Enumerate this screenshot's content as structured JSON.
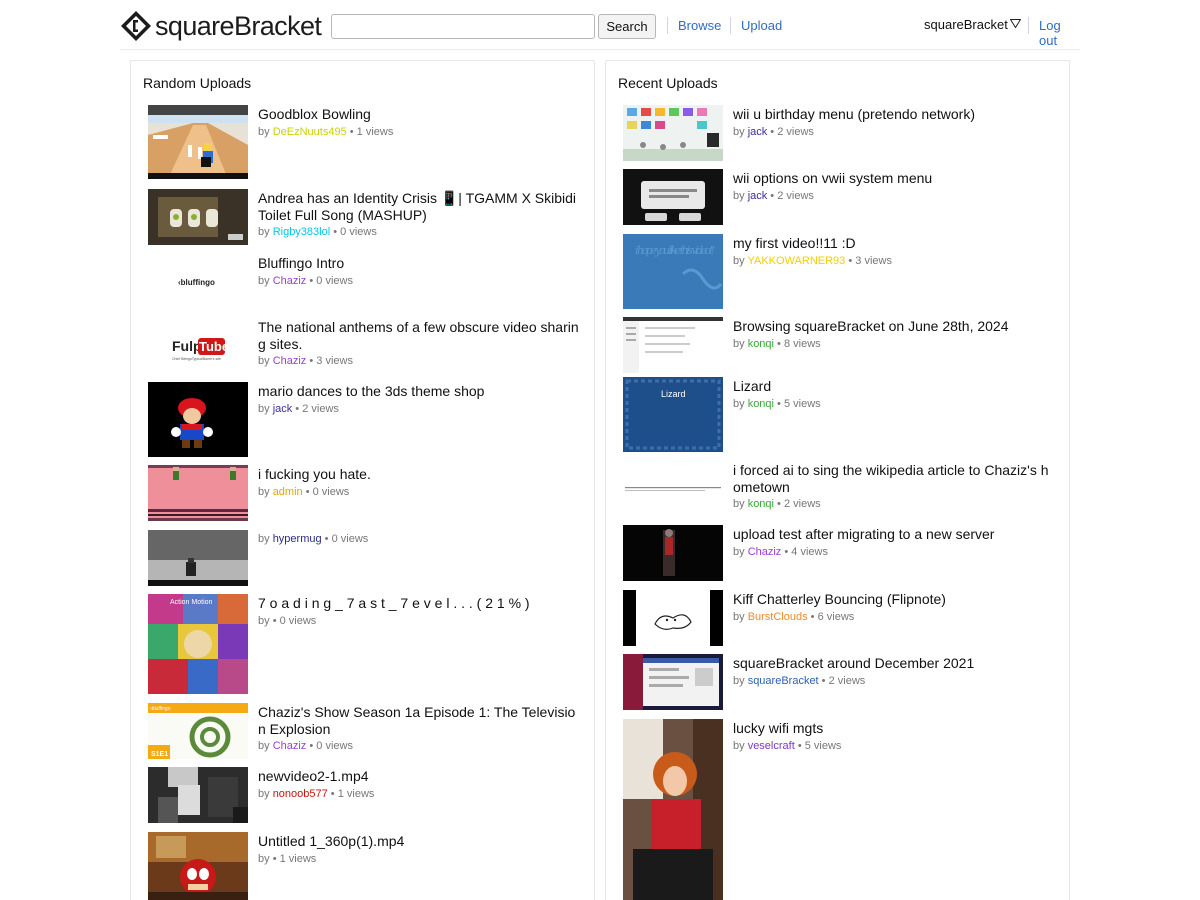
{
  "header": {
    "logo_text": "squareBracket",
    "search_placeholder": "",
    "search_button": "Search",
    "nav_browse": "Browse",
    "nav_upload": "Upload",
    "user_name": "squareBracket",
    "logout": "Log out"
  },
  "random": {
    "title": "Random Uploads",
    "videos": [
      {
        "title": "Goodblox Bowling",
        "user": "DeEzNuuts495",
        "user_color": "#c8d400",
        "views": "1 views"
      },
      {
        "title": "Andrea has an Identity Crisis 📱| TGAMM X Skibidi Toilet Full Song (MASHUP)",
        "user": "Rigby383lol",
        "user_color": "#00c8e6",
        "views": "0 views"
      },
      {
        "title": "Bluffingo Intro",
        "user": "Chaziz",
        "user_color": "#9b3dd6",
        "views": "0 views"
      },
      {
        "title": "The national anthems of a few obscure video sharing sites.",
        "user": "Chaziz",
        "user_color": "#9b3dd6",
        "views": "3 views"
      },
      {
        "title": "mario dances to the 3ds theme shop",
        "user": "jack",
        "user_color": "#3a2fa3",
        "views": "2 views"
      },
      {
        "title": "i fucking you hate.",
        "user": "admin",
        "user_color": "#e0a800",
        "views": "0 views"
      },
      {
        "title": "",
        "user": "hypermug",
        "user_color": "#2b2b8f",
        "views": "0 views"
      },
      {
        "title": "7 o a d i n g _ 7 a s t _ 7 e v e l . . . ( 2 1 % )",
        "user": "",
        "user_color": "#777777",
        "views": "0 views"
      },
      {
        "title": "Chaziz's Show Season 1a Episode 1: The Television Explosion",
        "user": "Chaziz",
        "user_color": "#9b3dd6",
        "views": "0 views"
      },
      {
        "title": "newvideo2-1.mp4",
        "user": "nonoob577",
        "user_color": "#cc1111",
        "views": "1 views"
      },
      {
        "title": "Untitled 1_360p(1).mp4",
        "user": "",
        "user_color": "#777777",
        "views": "1 views"
      }
    ]
  },
  "recent": {
    "title": "Recent Uploads",
    "videos": [
      {
        "title": "wii u birthday menu (pretendo network)",
        "user": "jack",
        "user_color": "#3a2fa3",
        "views": "2 views"
      },
      {
        "title": "wii options on vwii system menu",
        "user": "jack",
        "user_color": "#3a2fa3",
        "views": "2 views"
      },
      {
        "title": "my first video!!11 :D",
        "user": "YAKKOWARNER93",
        "user_color": "#f2d000",
        "views": "3 views"
      },
      {
        "title": "Browsing squareBracket on June 28th, 2024",
        "user": "konqi",
        "user_color": "#3aa83a",
        "views": "8 views"
      },
      {
        "title": "Lizard",
        "user": "konqi",
        "user_color": "#3aa83a",
        "views": "5 views"
      },
      {
        "title": "i forced ai to sing the wikipedia article to Chaziz's hometown",
        "user": "konqi",
        "user_color": "#3aa83a",
        "views": "2 views"
      },
      {
        "title": "upload test after migrating to a new server",
        "user": "Chaziz",
        "user_color": "#9b3dd6",
        "views": "4 views"
      },
      {
        "title": "Kiff Chatterley Bouncing (Flipnote)",
        "user": "BurstClouds",
        "user_color": "#f08a2c",
        "views": "6 views"
      },
      {
        "title": "squareBracket around December 2021",
        "user": "squareBracket",
        "user_color": "#2d5fb8",
        "views": "2 views"
      },
      {
        "title": "lucky wifi mgts",
        "user": "veselcraft",
        "user_color": "#7a3ac8",
        "views": "5 views"
      }
    ]
  },
  "thumb_text": {
    "bluffingo_logo": "‹bluffingo",
    "fulptube_a": "Fulp",
    "fulptube_b": "Tube",
    "fulptube_sub": "Chief BeingsTypicalName's site",
    "action_motion": "Action Motion",
    "bluffingo_small": "‹bluffingo",
    "episode_label": "S1E1",
    "handwritten": "i hope you like this video!!",
    "lizard_label": "Lizard"
  }
}
